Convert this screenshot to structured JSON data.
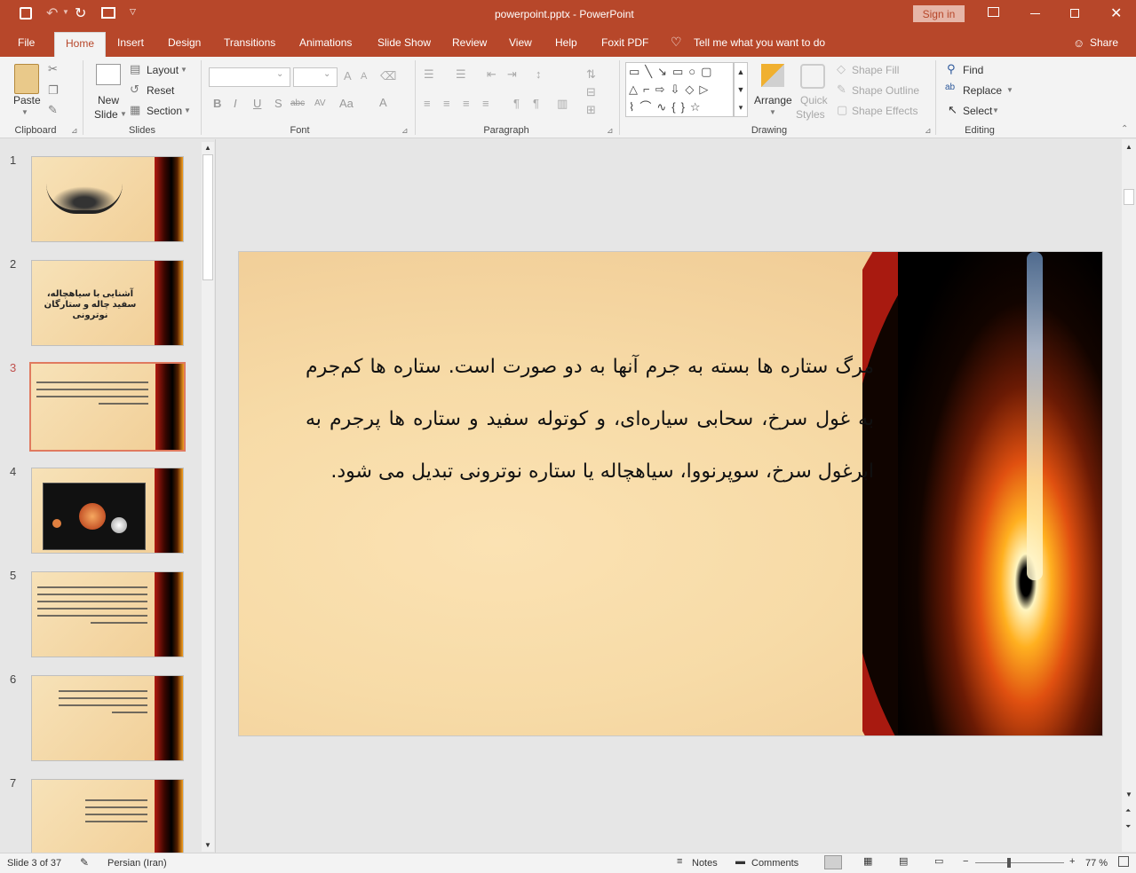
{
  "window": {
    "title": "powerpoint.pptx  -  PowerPoint",
    "sign_in": "Sign in"
  },
  "tabs": [
    "File",
    "Home",
    "Insert",
    "Design",
    "Transitions",
    "Animations",
    "Slide Show",
    "Review",
    "View",
    "Help",
    "Foxit PDF"
  ],
  "tell_me": "Tell me what you want to do",
  "share": "Share",
  "ribbon": {
    "clipboard": {
      "paste": "Paste",
      "group": "Clipboard"
    },
    "slides": {
      "new_slide_1": "New",
      "new_slide_2": "Slide",
      "layout": "Layout",
      "reset": "Reset",
      "section": "Section",
      "group": "Slides"
    },
    "font": {
      "group": "Font"
    },
    "paragraph": {
      "group": "Paragraph"
    },
    "drawing": {
      "arrange": "Arrange",
      "quick_styles_1": "Quick",
      "quick_styles_2": "Styles",
      "shape_fill": "Shape Fill",
      "shape_outline": "Shape Outline",
      "shape_effects": "Shape Effects",
      "group": "Drawing"
    },
    "editing": {
      "find": "Find",
      "replace": "Replace",
      "select": "Select",
      "group": "Editing"
    }
  },
  "thumbnails": [
    {
      "num": "1",
      "text": "",
      "selected": false
    },
    {
      "num": "2",
      "text": "آشنایی با سیاهچاله، سفید چاله و ستارگان نوترونی",
      "selected": false
    },
    {
      "num": "3",
      "text": "",
      "selected": true
    },
    {
      "num": "4",
      "text": "",
      "selected": false
    },
    {
      "num": "5",
      "text": "",
      "selected": false
    },
    {
      "num": "6",
      "text": "",
      "selected": false
    },
    {
      "num": "7",
      "text": "",
      "selected": false
    }
  ],
  "slide": {
    "text": "مرگ ستاره ها بسته به جرم آنها به دو صورت است. ستاره ها کم‌جرم به غول سرخ، سحابی سیاره‌ای، و کوتوله سفید و ستاره ها پرجرم به ابرغول سرخ، سوپرنووا، سیاهچاله یا ستاره نوترونی تبدیل می شود."
  },
  "status": {
    "slide": "Slide 3 of 37",
    "language": "Persian (Iran)",
    "notes": "Notes",
    "comments": "Comments",
    "zoom": "77 %"
  },
  "colors": {
    "accent": "#b7472a",
    "selected_thumb": "#e07a5f"
  }
}
